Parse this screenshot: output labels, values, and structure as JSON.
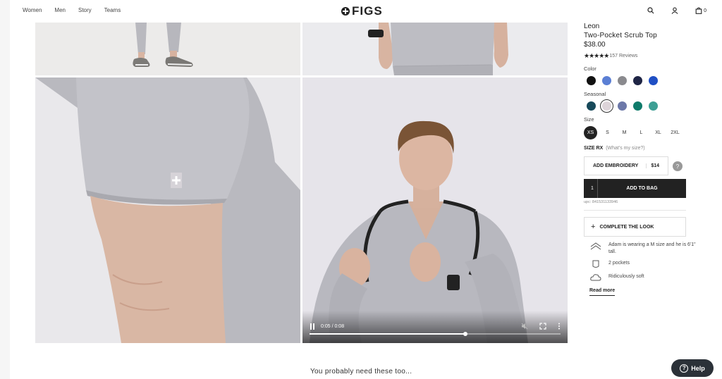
{
  "header": {
    "nav": [
      "Women",
      "Men",
      "Story",
      "Teams"
    ],
    "logo_text": "FIGS",
    "cart_count": "0"
  },
  "video": {
    "time": "0:05 / 0:08",
    "progress": 0.62
  },
  "product": {
    "brand": "Leon",
    "name": "Two-Pocket Scrub Top",
    "price": "$38.00",
    "stars": "★★★★★",
    "reviews": "157 Reviews",
    "color_label": "Color",
    "colors": [
      "#111111",
      "#5b7fd4",
      "#8a8a8e",
      "#1f2545",
      "#1f4fc4"
    ],
    "seasonal_label": "Seasonal",
    "seasonal": [
      "#17495a",
      "#ddd4d9",
      "#6c78a8",
      "#0f7b6b",
      "#3d9f94"
    ],
    "seasonal_selected": 1,
    "size_label": "Size",
    "sizes": [
      "XS",
      "S",
      "M",
      "L",
      "XL",
      "2XL"
    ],
    "size_selected": 0,
    "size_rx": "SIZE RX",
    "size_help": "(What's my size?)",
    "embroidery_label": "ADD EMBROIDERY",
    "embroidery_price": "$14",
    "help_q": "?",
    "quantity": "1",
    "add_to_bag": "ADD TO BAG",
    "upc": "upc: 841531133946",
    "complete_look": "COMPLETE THE LOOK",
    "features": [
      "Adam is wearing a M size and he is 6'1\" tall.",
      "2 pockets",
      "Ridiculously soft"
    ],
    "read_more": "Read more"
  },
  "recommend_title": "You probably need these too...",
  "help_button": "Help"
}
